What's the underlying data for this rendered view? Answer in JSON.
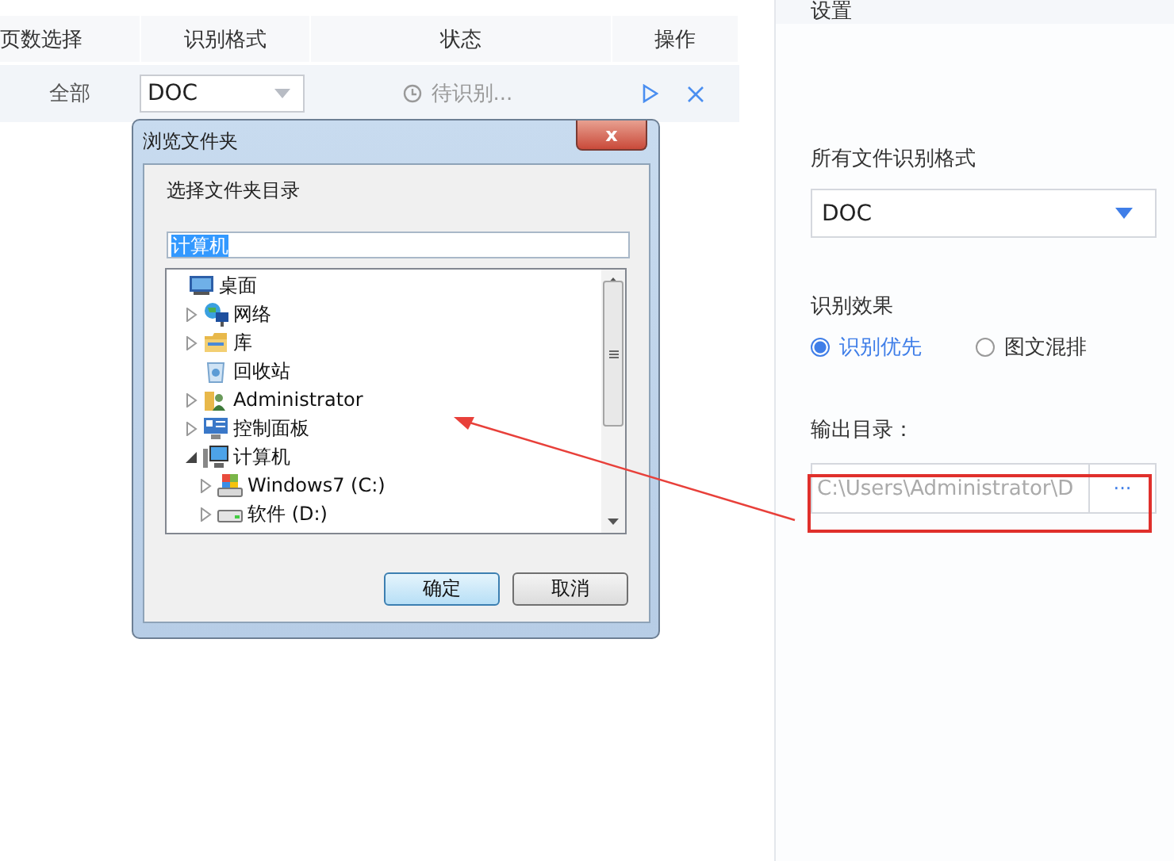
{
  "table": {
    "columns": [
      "页数选择",
      "识别格式",
      "状态",
      "操作"
    ],
    "rows": [
      {
        "pages": "全部",
        "format": "DOC",
        "status": "待识别..."
      }
    ]
  },
  "settings": {
    "title": "设置",
    "format_label": "所有文件识别格式",
    "format_value": "DOC",
    "effect_label": "识别效果",
    "effect_options": [
      {
        "label": "识别优先",
        "selected": true
      },
      {
        "label": "图文混排",
        "selected": false
      }
    ],
    "output_label": "输出目录：",
    "output_path": "C:\\Users\\Administrator\\D",
    "browse_button": "···"
  },
  "dialog": {
    "title": "浏览文件夹",
    "close": "x",
    "prompt": "选择文件夹目录",
    "folder_value": "计算机",
    "tree": [
      {
        "label": "桌面",
        "kind": "desktop",
        "children": [
          {
            "label": "网络",
            "kind": "network",
            "expandable": true,
            "expanded": false
          },
          {
            "label": "库",
            "kind": "library",
            "expandable": true,
            "expanded": false
          },
          {
            "label": "回收站",
            "kind": "recycle"
          },
          {
            "label": "Administrator",
            "kind": "user",
            "expandable": true,
            "expanded": false
          },
          {
            "label": "控制面板",
            "kind": "control",
            "expandable": true,
            "expanded": false
          },
          {
            "label": "计算机",
            "kind": "computer",
            "expandable": true,
            "expanded": true,
            "children": [
              {
                "label": "Windows7 (C:)",
                "kind": "system",
                "expandable": true,
                "expanded": false
              },
              {
                "label": "软件 (D:)",
                "kind": "drive",
                "expandable": true,
                "expanded": false
              }
            ]
          }
        ]
      }
    ],
    "buttons": [
      "确定",
      "取消"
    ]
  },
  "annotations": {
    "arrow": true,
    "output_frame": true
  }
}
